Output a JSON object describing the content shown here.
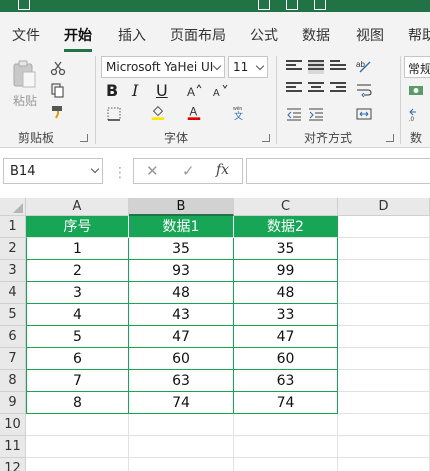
{
  "ribbon": {
    "tabs": [
      "文件",
      "开始",
      "插入",
      "页面布局",
      "公式",
      "数据",
      "视图",
      "帮助"
    ],
    "active_tab": "开始",
    "accent_color": "#217346",
    "clipboard": {
      "paste_label": "粘贴",
      "group_label": "剪贴板"
    },
    "font": {
      "name": "Microsoft YaHei UI",
      "size": "11",
      "group_label": "字体",
      "bold": "B",
      "italic": "I",
      "underline": "U"
    },
    "alignment": {
      "group_label": "对齐方式"
    },
    "number": {
      "format": "常规",
      "group_label": "数"
    }
  },
  "formula_bar": {
    "name_box": "B14",
    "cancel": "✕",
    "enter": "✓",
    "fx": "fx",
    "content": ""
  },
  "sheet": {
    "columns": [
      "A",
      "B",
      "C",
      "D"
    ],
    "rows": [
      "1",
      "2",
      "3",
      "4",
      "5",
      "6",
      "7",
      "8",
      "9",
      "10",
      "11",
      "12"
    ],
    "selected_cell": "B14",
    "header_fill": "#17a655",
    "table_header": [
      "序号",
      "数据1",
      "数据2"
    ],
    "table_rows": [
      [
        "1",
        "35",
        "35"
      ],
      [
        "2",
        "93",
        "99"
      ],
      [
        "3",
        "48",
        "48"
      ],
      [
        "4",
        "43",
        "33"
      ],
      [
        "5",
        "47",
        "47"
      ],
      [
        "6",
        "60",
        "60"
      ],
      [
        "7",
        "63",
        "63"
      ],
      [
        "8",
        "74",
        "74"
      ]
    ]
  }
}
